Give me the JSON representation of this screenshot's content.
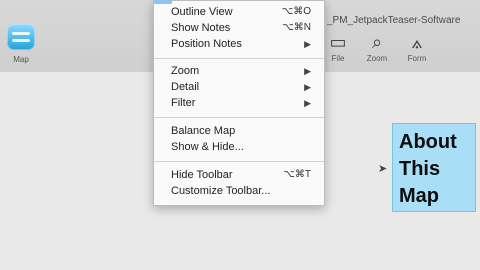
{
  "window": {
    "title": "_PM_JetpackTeaser-Software"
  },
  "toolbar": {
    "left_label": "Map",
    "file_label": "File",
    "zoom_label": "Zoom",
    "form_label": "Form"
  },
  "menu": {
    "items": [
      {
        "label": "Outline View",
        "shortcut": "⌥⌘O"
      },
      {
        "label": "Show Notes",
        "shortcut": "⌥⌘N"
      },
      {
        "label": "Position Notes",
        "arrow": "▶"
      },
      {
        "label": "Zoom",
        "arrow": "▶"
      },
      {
        "label": "Detail",
        "arrow": "▶"
      },
      {
        "label": "Filter",
        "arrow": "▶"
      },
      {
        "label": "Balance Map"
      },
      {
        "label": "Show & Hide..."
      },
      {
        "label": "Hide Toolbar",
        "shortcut": "⌥⌘T"
      },
      {
        "label": "Customize Toolbar..."
      }
    ]
  },
  "canvas": {
    "note_lines": [
      "About",
      "This",
      "Map"
    ]
  },
  "icons": {
    "left_tool": "map-view-icon",
    "file_tool": "file-icon",
    "zoom_tool": "zoom-icon",
    "form_tool": "form-icon"
  }
}
